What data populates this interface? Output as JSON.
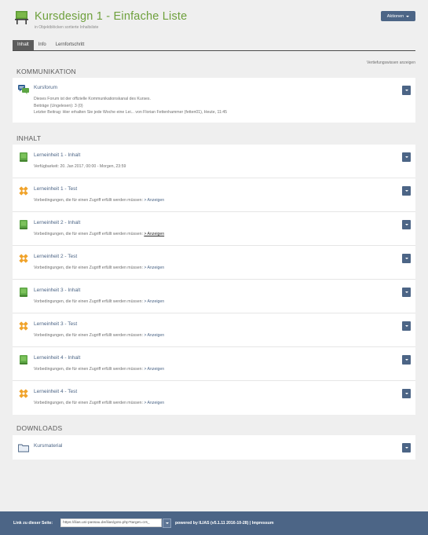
{
  "header": {
    "title": "Kursdesign 1 - Einfache Liste",
    "subtitle": "in Objektblöcken sortierte Inhaltsliste",
    "actions_label": "Aktionen",
    "course_icon": "course-board-icon"
  },
  "tabs": [
    {
      "label": "Inhalt",
      "active": true
    },
    {
      "label": "Info",
      "active": false
    },
    {
      "label": "Lernfortschritt",
      "active": false
    }
  ],
  "toggle_details_label": "Vertiefungswissen anzeigen",
  "sections": {
    "kommunikation": {
      "title": "KOMMUNIKATION",
      "forum": {
        "icon": "forum-icon",
        "title": "Kursforum",
        "description": "Dieses Forum ist der offizielle Kommunikationskanal des Kurses.",
        "posts": "Beiträge (Ungelesen): 3 (0)",
        "last_post": "Letzter Beitrag: Hier erhalten Sie jede Woche eine Lei... von Florian Fettenhammer (fetten01), Heute, 11:45"
      }
    },
    "inhalt": {
      "title": "INHALT",
      "items": [
        {
          "icon": "learning-module-icon",
          "title": "Lerneinheit 1 - Inhalt",
          "line": "Verfügbarkeit: 20. Jan 2017, 00:00 - Morgen, 23:59",
          "link": ""
        },
        {
          "icon": "test-icon",
          "title": "Lerneinheit 1 - Test",
          "line": "Vorbedingungen, die für einen Zugriff erfüllt werden müssen: ",
          "link": "> Anzeigen"
        },
        {
          "icon": "learning-module-icon",
          "title": "Lerneinheit 2 - Inhalt",
          "line": "Vorbedingungen, die für einen Zugriff erfüllt werden müssen: ",
          "link": "> Anzeigen"
        },
        {
          "icon": "test-icon",
          "title": "Lerneinheit 2 - Test",
          "line": "Vorbedingungen, die für einen Zugriff erfüllt werden müssen: ",
          "link": "> Anzeigen"
        },
        {
          "icon": "learning-module-icon",
          "title": "Lerneinheit 3 - Inhalt",
          "line": "Vorbedingungen, die für einen Zugriff erfüllt werden müssen: ",
          "link": "> Anzeigen"
        },
        {
          "icon": "test-icon",
          "title": "Lerneinheit 3 - Test",
          "line": "Vorbedingungen, die für einen Zugriff erfüllt werden müssen: ",
          "link": "> Anzeigen"
        },
        {
          "icon": "learning-module-icon",
          "title": "Lerneinheit 4 - Inhalt",
          "line": "Vorbedingungen, die für einen Zugriff erfüllt werden müssen: ",
          "link": "> Anzeigen"
        },
        {
          "icon": "test-icon",
          "title": "Lerneinheit 4 - Test",
          "line": "Vorbedingungen, die für einen Zugriff erfüllt werden müssen: ",
          "link": "> Anzeigen"
        }
      ]
    },
    "downloads": {
      "title": "DOWNLOADS",
      "folder": {
        "icon": "folder-icon",
        "title": "Kursmaterial"
      }
    }
  },
  "footer": {
    "link_label": "Link zu dieser Seite:",
    "link_value": "https://ilias.uni-passau.de/ilias/goto.php?target=crs_",
    "powered_by": "powered by ILIAS (v5.1.11 2016-10-28)",
    "separator": "|",
    "impressum": "Impressum"
  },
  "colors": {
    "accent_green": "#6ea03c",
    "link_blue": "#4c6586",
    "test_orange": "#f0a32b",
    "footer_bg": "#4c6586"
  }
}
